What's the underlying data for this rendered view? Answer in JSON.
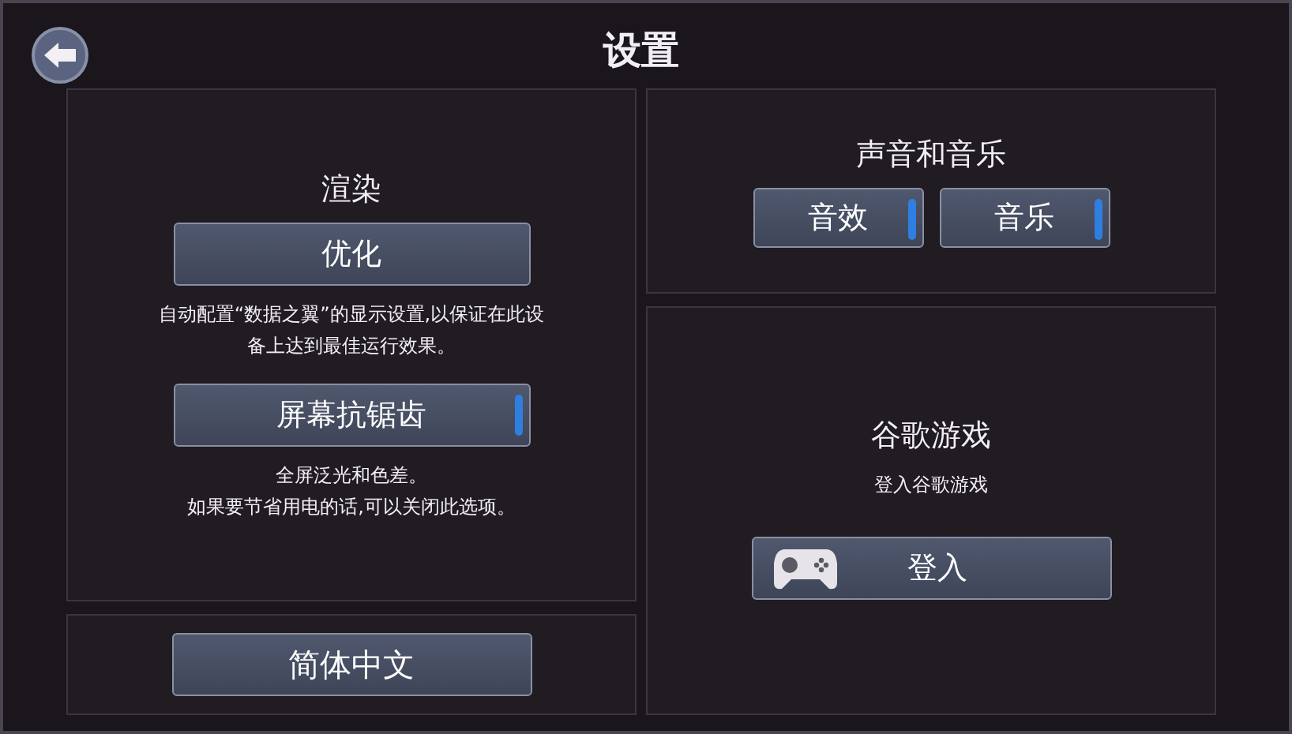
{
  "title": "设置",
  "render": {
    "heading": "渲染",
    "items": [
      {
        "kind": "button",
        "label": "优化",
        "note": [
          "自动配置“数据之翼”的显示设置,以保证在此设",
          "备上达到最佳运行效果。"
        ]
      },
      {
        "kind": "toggle",
        "label": "屏幕抗锯齿",
        "on": true,
        "note": [
          "全屏泛光和色差。",
          "如果要节省用电的话,可以关闭此选项。"
        ]
      }
    ]
  },
  "language": {
    "label": "简体中文"
  },
  "sound": {
    "heading": "声音和音乐",
    "toggles": [
      {
        "label": "音效",
        "on": true
      },
      {
        "label": "音乐",
        "on": true
      }
    ]
  },
  "google": {
    "heading": "谷歌游戏",
    "subtitle": "登入谷歌游戏",
    "button": "登入"
  }
}
